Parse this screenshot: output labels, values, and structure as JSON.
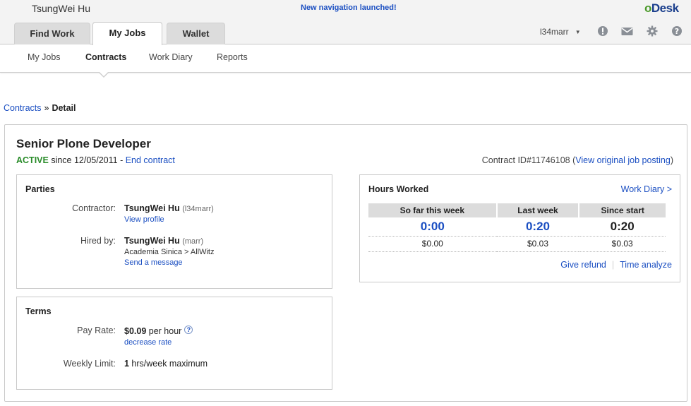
{
  "header": {
    "user_name": "TsungWei Hu",
    "announcement": "New navigation launched!",
    "logo_prefix": "o",
    "logo_rest": "Desk",
    "main_tabs": [
      {
        "label": "Find Work"
      },
      {
        "label": "My Jobs"
      },
      {
        "label": "Wallet"
      }
    ],
    "account": "l34marr",
    "icons": [
      "alert-icon",
      "mail-icon",
      "gear-icon",
      "help-icon"
    ]
  },
  "subnav": {
    "items": [
      {
        "label": "My Jobs"
      },
      {
        "label": "Contracts"
      },
      {
        "label": "Work Diary"
      },
      {
        "label": "Reports"
      }
    ]
  },
  "breadcrumb": {
    "parent": "Contracts",
    "separator": "»",
    "current": "Detail"
  },
  "contract": {
    "title": "Senior Plone Developer",
    "status": "ACTIVE",
    "since": " since 12/05/2011 - ",
    "end_link": "End contract",
    "id_label": "Contract ID#11746108 (",
    "view_posting": "View original job posting",
    "close_paren": ")"
  },
  "parties": {
    "title": "Parties",
    "contractor_label": "Contractor:",
    "contractor_name": "TsungWei Hu",
    "contractor_handle": "(l34marr)",
    "view_profile": "View profile",
    "hired_by_label": "Hired by:",
    "hirer_name": "TsungWei Hu",
    "hirer_handle": "(marr)",
    "hirer_company": "Academia Sinica > AllWitz",
    "send_message": "Send a message"
  },
  "terms": {
    "title": "Terms",
    "pay_rate_label": "Pay Rate:",
    "pay_rate_value": "$0.09",
    "pay_rate_unit": " per hour",
    "help": "?",
    "decrease_rate": "decrease rate",
    "weekly_limit_label": "Weekly Limit:",
    "weekly_limit_value": "1",
    "weekly_limit_unit": " hrs/week maximum"
  },
  "hours": {
    "title": "Hours Worked",
    "work_diary_link": "Work Diary >",
    "columns": [
      "So far this week",
      "Last week",
      "Since start"
    ],
    "times": [
      "0:00",
      "0:20",
      "0:20"
    ],
    "amounts": [
      "$0.00",
      "$0.03",
      "$0.03"
    ],
    "give_refund": "Give refund",
    "time_analyze": "Time analyze"
  },
  "colors": {
    "link": "#1b4fc2",
    "active_status": "#2a8c2a",
    "tab_inactive": "#dcdcdc",
    "header_bg": "#f3f3f3"
  }
}
